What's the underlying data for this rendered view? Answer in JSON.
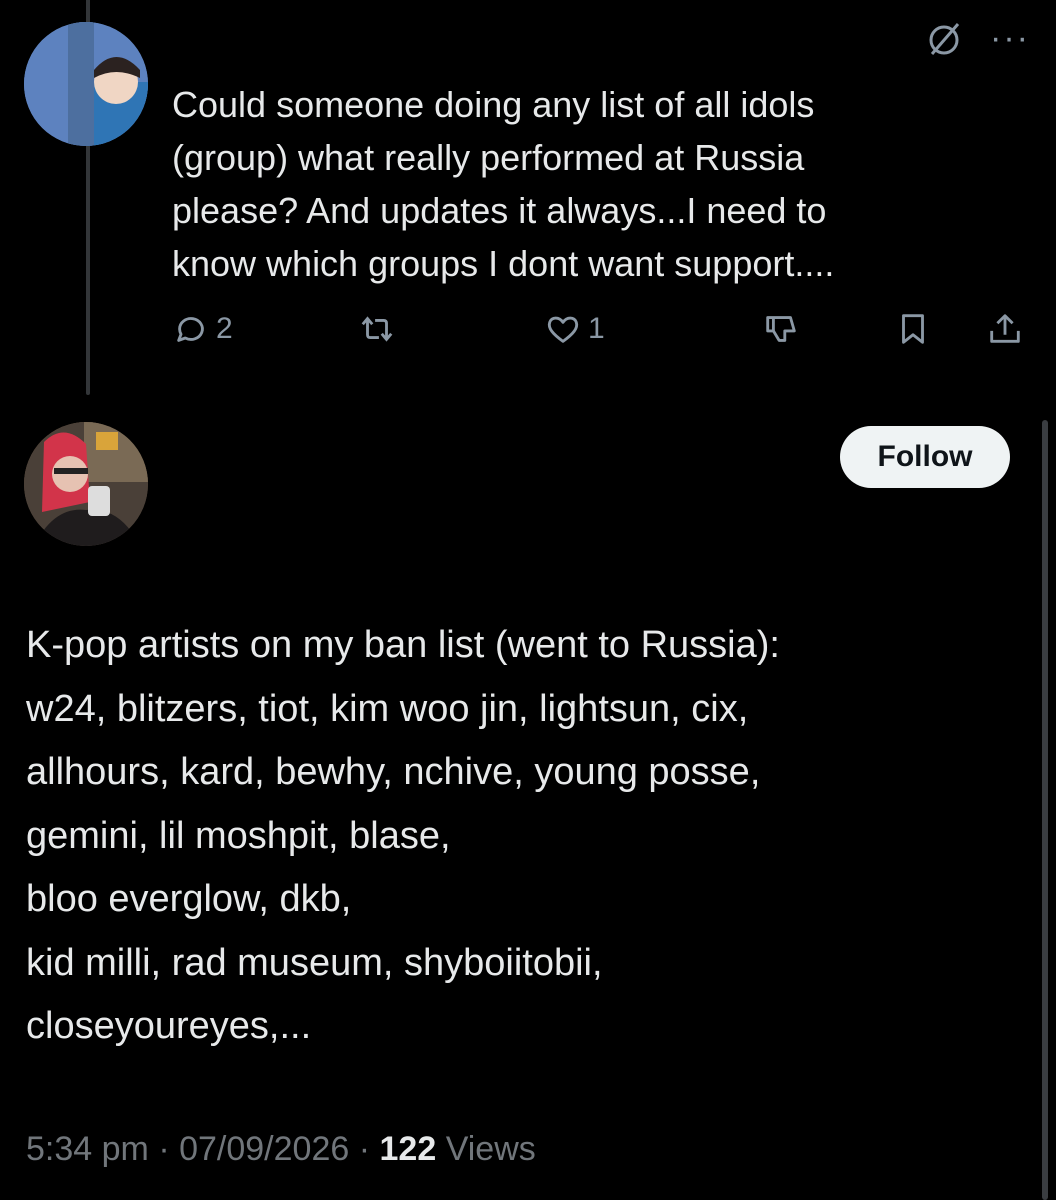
{
  "reply_to": {
    "author_name": "",
    "text": "Could someone doing any list of all idols (group) what really performed at Russia please? And updates it always...I need to know which groups I dont want support....",
    "text_lines": [
      "Could someone doing any list of all idols",
      "(group) what really performed at Russia",
      "please? And updates it always...I need to",
      "know which groups I dont want support...."
    ],
    "replies": "2",
    "reposts": "",
    "likes": "1",
    "icons": [
      "grok-icon",
      "more-icon",
      "reply-icon",
      "repost-icon",
      "like-icon",
      "downvote-icon",
      "bookmark-icon",
      "share-icon"
    ]
  },
  "tweet": {
    "follow_label": "Follow",
    "text_lines": [
      "K-pop artists on my ban list (went to Russia):",
      "w24, blitzers, tiot, kim woo jin, lightsun, cix,",
      "allhours, kard, bewhy, nchive, young posse,",
      "gemini, lil moshpit, blase,",
      "bloo everglow, dkb,",
      "kid milli, rad museum, shyboiitobii,",
      "closeyoureyes,..."
    ],
    "time": "5:34 pm",
    "date": "07/09/2026",
    "views_count": "122",
    "views_label": "Views"
  },
  "colors": {
    "background": "#000000",
    "text": "#e7e9ea",
    "muted": "#71767b",
    "follow_bg": "#eff3f4"
  }
}
